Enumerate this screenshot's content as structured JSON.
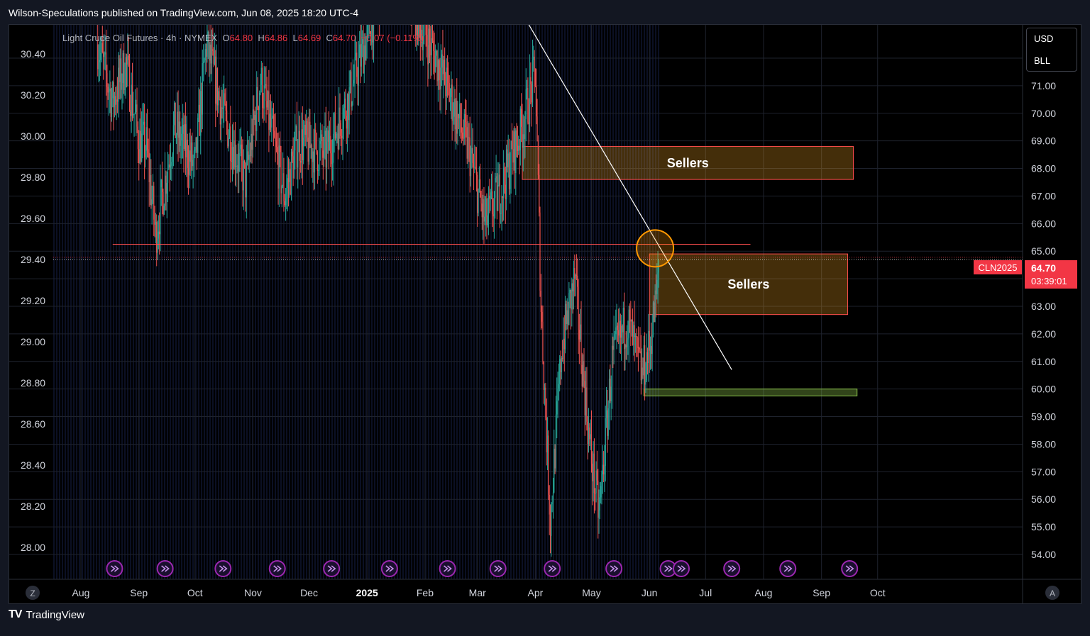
{
  "header": {
    "text": "Wilson-Speculations published on TradingView.com, Jun 08, 2025 18:20 UTC-4"
  },
  "legend": {
    "name": "Light Crude Oil Futures · 4h · NYMEX",
    "o_label": "O",
    "o_value": "64.80",
    "h_label": "H",
    "h_value": "64.86",
    "l_label": "L",
    "l_value": "64.69",
    "c_label": "C",
    "c_value": "64.70",
    "change": "−0.07 (−0.11%)"
  },
  "units": {
    "currency": "USD",
    "unit": "BLL"
  },
  "price_tag": {
    "symbol": "CLN2025",
    "price": "64.70",
    "countdown": "03:39:01"
  },
  "corner": {
    "left": "Z",
    "right": "A"
  },
  "footer": {
    "brand": "TradingView"
  },
  "colors": {
    "background": "#000000",
    "up": "#26a69a",
    "down": "#ef5350",
    "zone_fill": "#f5a623",
    "zone_border": "#ff4d4d",
    "support_zone": "#8bc34a",
    "trendline": "#ffffff",
    "circle": "#ff9800",
    "event_icon": "#9c27b0",
    "price_tag": "#f23645"
  },
  "chart_data": {
    "type": "candlestick",
    "timeframe": "4h",
    "x_axis_labels": [
      "Aug",
      "Sep",
      "Oct",
      "Nov",
      "Dec",
      "2025",
      "Feb",
      "Mar",
      "Apr",
      "May",
      "Jun",
      "Jul",
      "Aug",
      "Sep",
      "Oct"
    ],
    "x_axis_dates": [
      "2024-08-01",
      "2024-09-01",
      "2024-10-01",
      "2024-11-01",
      "2024-12-01",
      "2025-01-01",
      "2025-02-01",
      "2025-03-01",
      "2025-04-01",
      "2025-05-01",
      "2025-06-01",
      "2025-07-01",
      "2025-08-01",
      "2025-09-01",
      "2025-10-01"
    ],
    "left_axis_ticks": [
      "30.40",
      "30.20",
      "30.00",
      "29.80",
      "29.60",
      "29.40",
      "29.20",
      "29.00",
      "28.80",
      "28.60",
      "28.40",
      "28.20",
      "28.00"
    ],
    "right_axis_ticks": [
      "71.00",
      "70.00",
      "69.00",
      "68.00",
      "67.00",
      "66.00",
      "65.00",
      "63.00",
      "62.00",
      "61.00",
      "60.00",
      "59.00",
      "58.00",
      "57.00",
      "56.00",
      "55.00",
      "54.00"
    ],
    "right_axis_range": [
      53.4,
      72.4
    ],
    "grid": true,
    "last_price": 64.7,
    "price_path": [
      {
        "date": "2024-08-10",
        "price": 72.5
      },
      {
        "date": "2024-08-18",
        "price": 70.4
      },
      {
        "date": "2024-08-25",
        "price": 71.8
      },
      {
        "date": "2024-09-01",
        "price": 69.0
      },
      {
        "date": "2024-09-05",
        "price": 68.8
      },
      {
        "date": "2024-09-10",
        "price": 65.6
      },
      {
        "date": "2024-09-20",
        "price": 69.5
      },
      {
        "date": "2024-10-01",
        "price": 68.0
      },
      {
        "date": "2024-10-07",
        "price": 72.5
      },
      {
        "date": "2024-10-16",
        "price": 70.0
      },
      {
        "date": "2024-10-28",
        "price": 67.5
      },
      {
        "date": "2024-11-05",
        "price": 71.2
      },
      {
        "date": "2024-11-18",
        "price": 67.0
      },
      {
        "date": "2024-11-25",
        "price": 69.0
      },
      {
        "date": "2024-12-10",
        "price": 68.5
      },
      {
        "date": "2024-12-22",
        "price": 70.5
      },
      {
        "date": "2025-01-02",
        "price": 73.0
      },
      {
        "date": "2025-01-15",
        "price": 76.0
      },
      {
        "date": "2025-01-28",
        "price": 73.5
      },
      {
        "date": "2025-02-10",
        "price": 71.5
      },
      {
        "date": "2025-02-25",
        "price": 68.5
      },
      {
        "date": "2025-03-05",
        "price": 66.0
      },
      {
        "date": "2025-03-15",
        "price": 67.5
      },
      {
        "date": "2025-03-25",
        "price": 69.5
      },
      {
        "date": "2025-04-01",
        "price": 71.5
      },
      {
        "date": "2025-04-04",
        "price": 63.0
      },
      {
        "date": "2025-04-09",
        "price": 55.2
      },
      {
        "date": "2025-04-15",
        "price": 61.5
      },
      {
        "date": "2025-04-22",
        "price": 64.0
      },
      {
        "date": "2025-04-30",
        "price": 58.0
      },
      {
        "date": "2025-05-05",
        "price": 55.4
      },
      {
        "date": "2025-05-12",
        "price": 61.0
      },
      {
        "date": "2025-05-20",
        "price": 62.5
      },
      {
        "date": "2025-05-28",
        "price": 60.5
      },
      {
        "date": "2025-06-01",
        "price": 61.5
      },
      {
        "date": "2025-06-05",
        "price": 63.5
      },
      {
        "date": "2025-06-06",
        "price": 64.7
      }
    ],
    "annotations": [
      {
        "type": "zone",
        "label": "Sellers",
        "start": "2025-03-25",
        "end": "2025-09-18",
        "low": 67.6,
        "high": 68.8
      },
      {
        "type": "zone",
        "label": "Sellers",
        "start": "2025-06-01",
        "end": "2025-09-15",
        "low": 62.7,
        "high": 64.9
      },
      {
        "type": "zone",
        "label": "",
        "start": "2025-05-29",
        "end": "2025-09-20",
        "low": 59.75,
        "high": 60.0
      },
      {
        "type": "hline",
        "start": "2024-08-18",
        "end": "2025-07-25",
        "price": 65.25
      },
      {
        "type": "trendline",
        "start_date": "2025-02-15",
        "start_price": 78.0,
        "end_date": "2025-07-15",
        "end_price": 60.7
      },
      {
        "type": "circle",
        "date": "2025-06-04",
        "price": 65.1
      }
    ],
    "event_markers": [
      "2024-08-19",
      "2024-09-15",
      "2024-10-16",
      "2024-11-14",
      "2024-12-13",
      "2025-01-13",
      "2025-02-13",
      "2025-03-12",
      "2025-04-10",
      "2025-05-13",
      "2025-06-11",
      "2025-06-18",
      "2025-07-15",
      "2025-08-14",
      "2025-09-16"
    ]
  }
}
